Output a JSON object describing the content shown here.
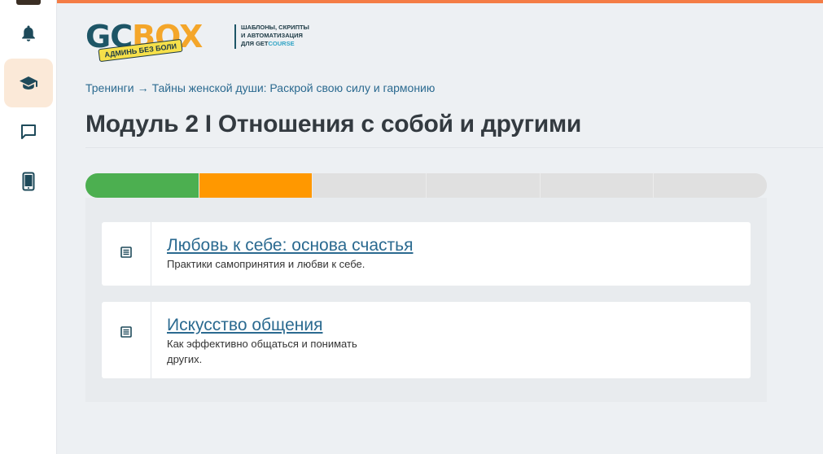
{
  "logo": {
    "gc": "GC",
    "box": "BOX",
    "badge": "АДМИНЬ БЕЗ БОЛИ",
    "tagline_1": "ШАБЛОНЫ, СКРИПТЫ",
    "tagline_2": "И АВТОМАТИЗАЦИЯ",
    "tagline_3a": "ДЛЯ GET",
    "tagline_3b": "COURSE"
  },
  "breadcrumb": {
    "parent": "Тренинги",
    "arrow": "→",
    "current": "Тайны женской души: Раскрой свою силу и гармонию"
  },
  "page": {
    "title": "Модуль 2 I Отношения с собой и другими"
  },
  "progress": {
    "segments": [
      {
        "status": "complete",
        "color": "#4caf50"
      },
      {
        "status": "in_progress",
        "color": "#ff9800"
      },
      {
        "status": "locked",
        "color": "#e0e0e0"
      },
      {
        "status": "locked",
        "color": "#e0e0e0"
      },
      {
        "status": "locked",
        "color": "#e0e0e0"
      },
      {
        "status": "locked",
        "color": "#e0e0e0"
      }
    ]
  },
  "lessons": [
    {
      "title": "Любовь к себе: основа счастья",
      "desc_lines": [
        "Практики самопринятия и любви к себе."
      ]
    },
    {
      "title": "Искусство общения",
      "desc_lines": [
        "Как эффективно общаться и понимать",
        "других."
      ]
    }
  ],
  "sidebar": {
    "items": [
      {
        "icon": "bell-icon",
        "active": false
      },
      {
        "icon": "graduation-cap-icon",
        "active": true
      },
      {
        "icon": "chat-icon",
        "active": false
      },
      {
        "icon": "mobile-phone-icon",
        "active": false
      }
    ]
  },
  "colors": {
    "accent": "#f47c45",
    "sidebar_icon": "#1e4a5a",
    "link": "#2b6a90",
    "active_bg": "#fbe9d8"
  }
}
